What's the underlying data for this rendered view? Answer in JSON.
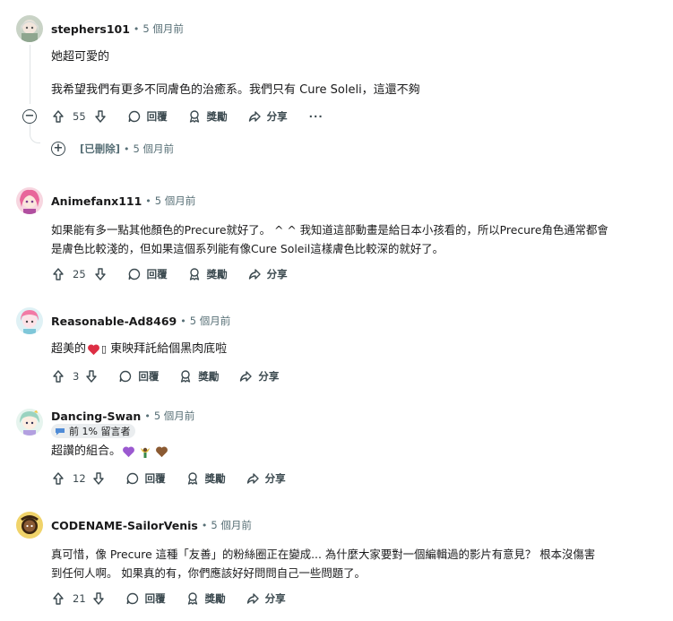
{
  "comments": [
    {
      "username": "stephers101",
      "time": "5 個月前",
      "lines": [
        "她超可愛的",
        "我希望我們有更多不同膚色的治癒系。我們只有 Cure Soleli，這還不夠"
      ],
      "votes": "55"
    },
    {
      "deleted_label": "[已刪除]",
      "time": "5 個月前"
    },
    {
      "username": "Animefanx111",
      "time": "5 個月前",
      "lines": [
        "如果能有多一點其他顏色的Precure就好了。 ^ ^ 我知道這部動畫是給日本小孩看的，所以Precure角色通常都會",
        "是膚色比較淺的，但如果這個系列能有像Cure Soleil這樣膚色比較深的就好了。"
      ],
      "votes": "25"
    },
    {
      "username": "Reasonable-Ad8469",
      "time": "5 個月前",
      "text_before": "超美的",
      "text_missing_glyph": "▯",
      "text_after": "東映拜託給個黑肉底啦",
      "votes": "3"
    },
    {
      "username": "Dancing-Swan",
      "time": "5 個月前",
      "flair": "前 1% 留言者",
      "text": "超讚的組合。",
      "votes": "12"
    },
    {
      "username": "CODENAME-SailorVenis",
      "time": "5 個月前",
      "lines": [
        "真可惜，像 Precure 這種「友善」的粉絲圈正在變成... 為什麼大家要對一個編輯過的影片有意見？ 根本沒傷害",
        "到任何人啊。 如果真的有，你們應該好好問問自己一些問題了。"
      ],
      "votes": "21"
    }
  ],
  "actions": {
    "reply": "回覆",
    "award": "獎勵",
    "share": "分享",
    "more": "···"
  },
  "separator": "•",
  "colors": {
    "text": "#1a1a1b",
    "meta": "#576f76",
    "action": "#3c4a50",
    "thread_line": "#dfe3e5",
    "flair_bg": "#eaedef"
  }
}
